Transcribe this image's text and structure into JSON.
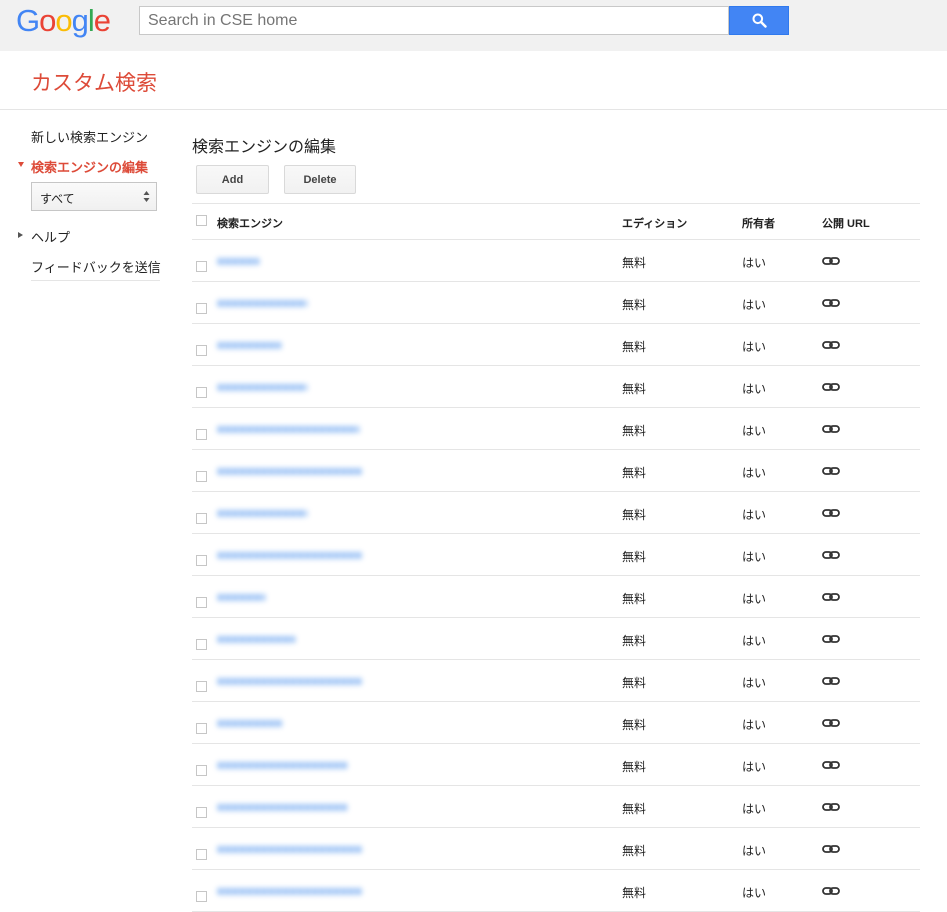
{
  "header": {
    "logo": "Google",
    "search_placeholder": "Search in CSE home"
  },
  "subheader": {
    "title": "カスタム検索"
  },
  "sidebar": {
    "items": [
      {
        "label": "新しい検索エンジン"
      },
      {
        "label": "検索エンジンの編集"
      },
      {
        "label": "ヘルプ"
      },
      {
        "label": "フィードバックを送信"
      }
    ],
    "filter_value": "すべて"
  },
  "main": {
    "title": "検索エンジンの編集",
    "add_label": "Add",
    "delete_label": "Delete",
    "table": {
      "headers": [
        "検索エンジン",
        "エディション",
        "所有者",
        "公開 URL"
      ],
      "rows": [
        {
          "edition": "無料",
          "owner": "はい"
        },
        {
          "edition": "無料",
          "owner": "はい"
        },
        {
          "edition": "無料",
          "owner": "はい"
        },
        {
          "edition": "無料",
          "owner": "はい"
        },
        {
          "edition": "無料",
          "owner": "はい"
        },
        {
          "edition": "無料",
          "owner": "はい"
        },
        {
          "edition": "無料",
          "owner": "はい"
        },
        {
          "edition": "無料",
          "owner": "はい"
        },
        {
          "edition": "無料",
          "owner": "はい"
        },
        {
          "edition": "無料",
          "owner": "はい"
        },
        {
          "edition": "無料",
          "owner": "はい"
        },
        {
          "edition": "無料",
          "owner": "はい"
        },
        {
          "edition": "無料",
          "owner": "はい"
        },
        {
          "edition": "無料",
          "owner": "はい"
        },
        {
          "edition": "無料",
          "owner": "はい"
        },
        {
          "edition": "無料",
          "owner": "はい"
        }
      ]
    }
  },
  "colors": {
    "accent": "#dd4b39",
    "search_button": "#4285f4",
    "link": "#1a73e8"
  },
  "icons": {
    "search": "search-icon",
    "public_url": "link-icon"
  }
}
